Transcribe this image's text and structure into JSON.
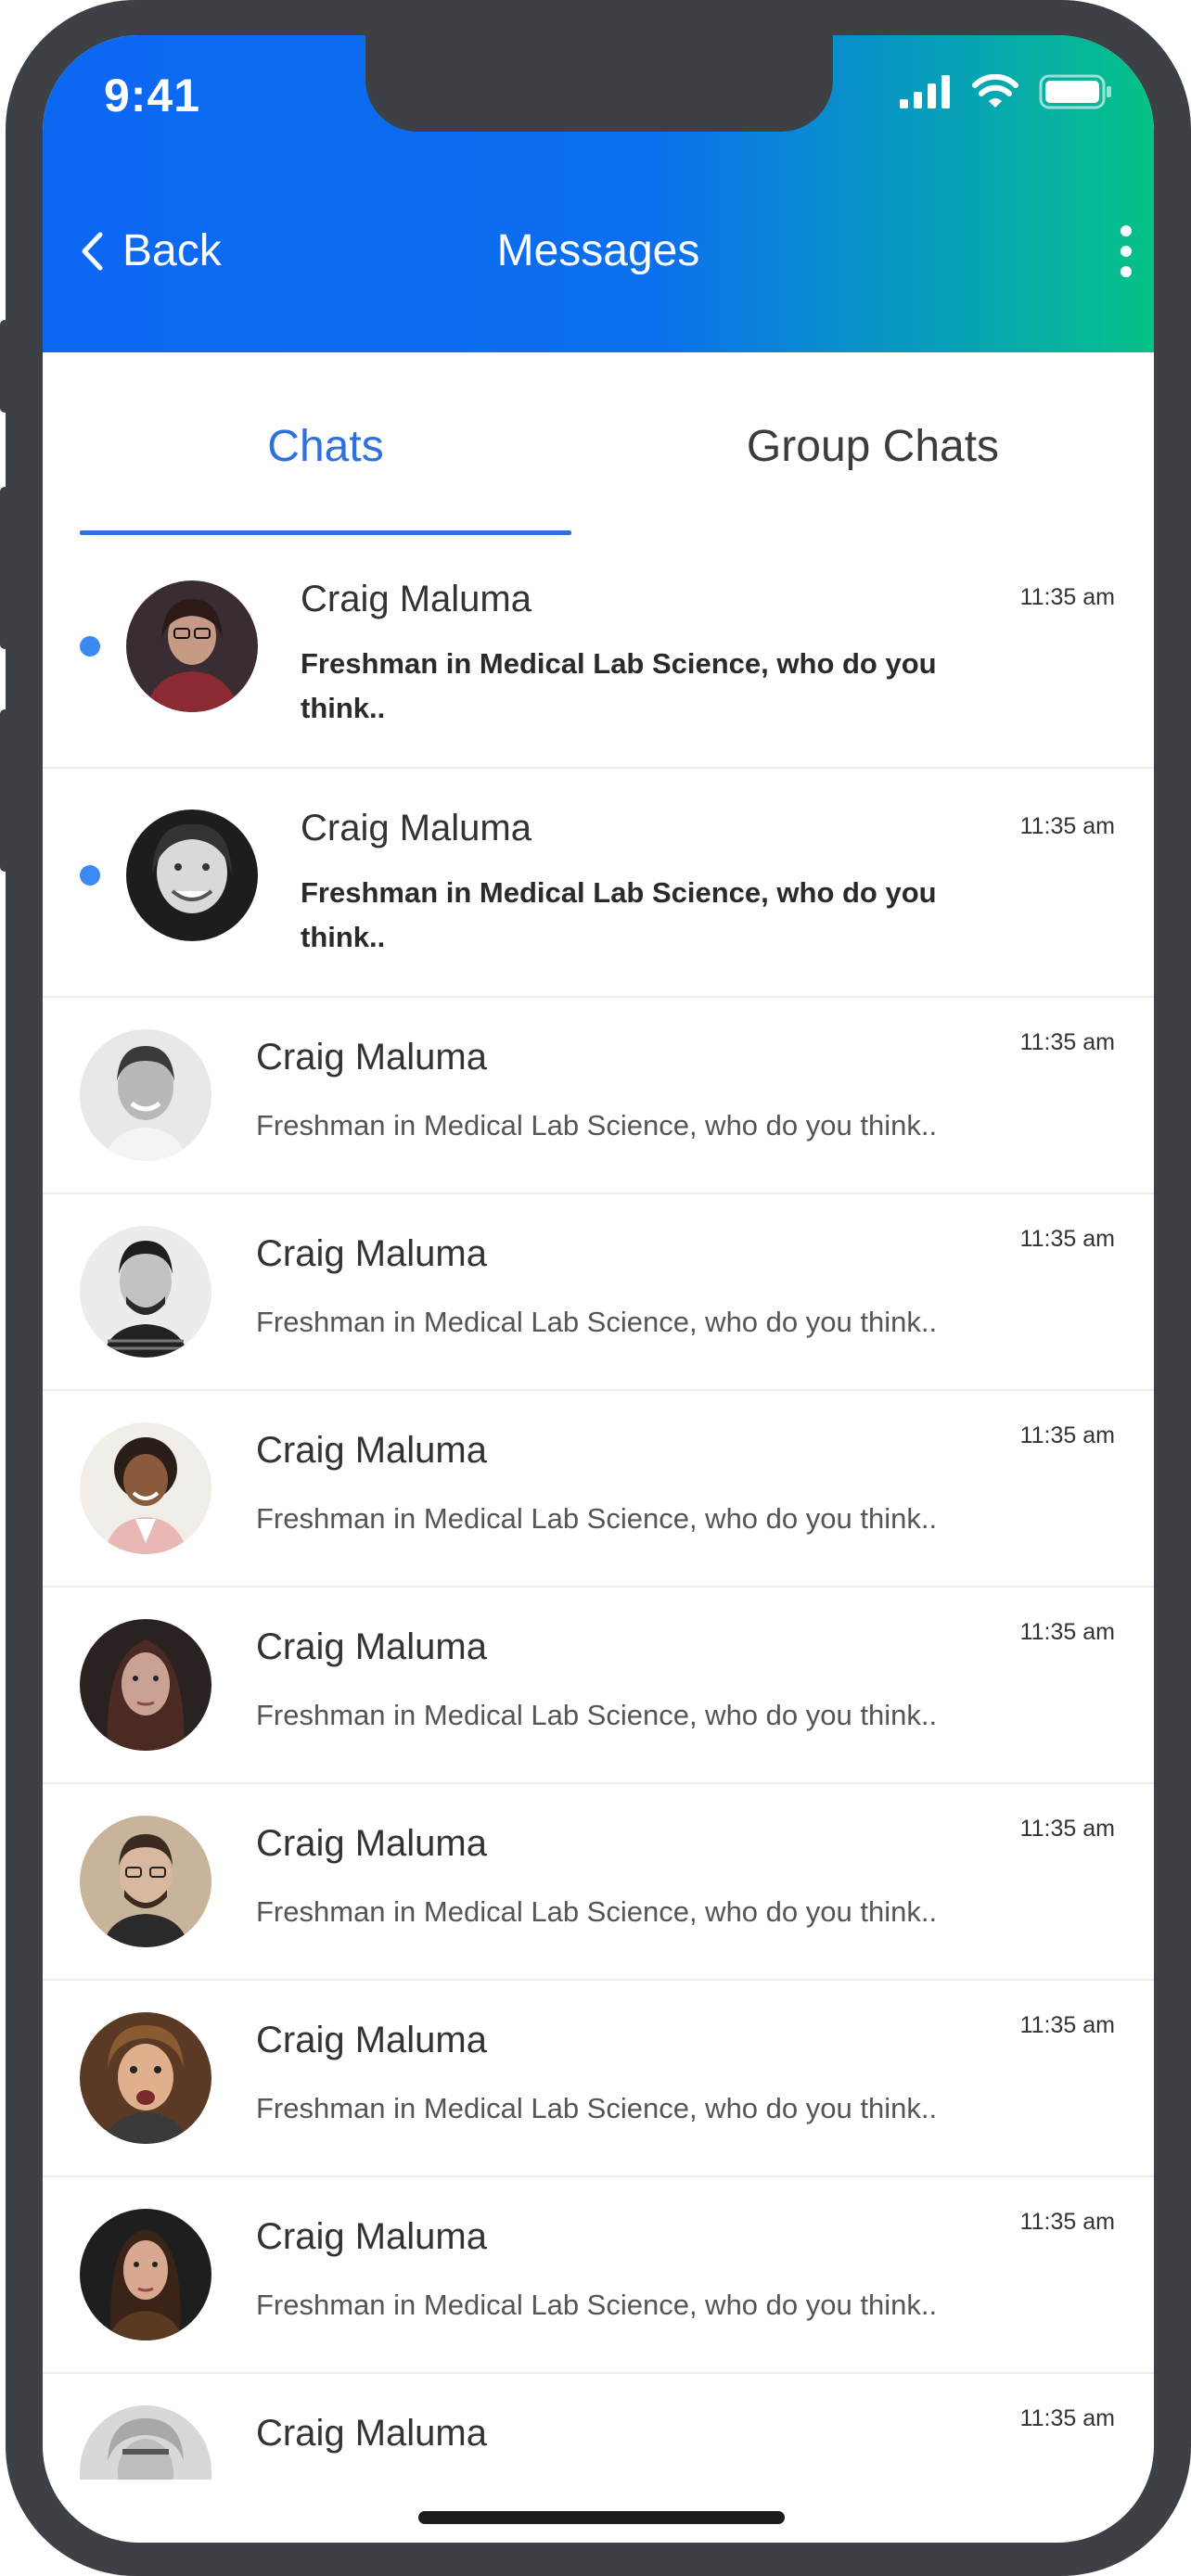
{
  "status_bar": {
    "time": "9:41"
  },
  "header": {
    "back_label": "Back",
    "title": "Messages"
  },
  "tabs": [
    {
      "label": "Chats",
      "active": true
    },
    {
      "label": "Group Chats",
      "active": false
    }
  ],
  "accent_color": "#2f6fde",
  "conversations": [
    {
      "name": "Craig Maluma",
      "message": "Freshman in Medical Lab Science, who do you think..",
      "time": "11:35 am",
      "unread": true
    },
    {
      "name": "Craig Maluma",
      "message": "Freshman in Medical Lab Science, who do you think..",
      "time": "11:35 am",
      "unread": true
    },
    {
      "name": "Craig Maluma",
      "message": "Freshman in Medical Lab Science, who do you think..",
      "time": "11:35 am",
      "unread": false
    },
    {
      "name": "Craig Maluma",
      "message": "Freshman in Medical Lab Science, who do you think..",
      "time": "11:35 am",
      "unread": false
    },
    {
      "name": "Craig Maluma",
      "message": "Freshman in Medical Lab Science, who do you think..",
      "time": "11:35 am",
      "unread": false
    },
    {
      "name": "Craig Maluma",
      "message": "Freshman in Medical Lab Science, who do you think..",
      "time": "11:35 am",
      "unread": false
    },
    {
      "name": "Craig Maluma",
      "message": "Freshman in Medical Lab Science, who do you think..",
      "time": "11:35 am",
      "unread": false
    },
    {
      "name": "Craig Maluma",
      "message": "Freshman in Medical Lab Science, who do you think..",
      "time": "11:35 am",
      "unread": false
    },
    {
      "name": "Craig Maluma",
      "message": "Freshman in Medical Lab Science, who do you think..",
      "time": "11:35 am",
      "unread": false
    },
    {
      "name": "Craig Maluma",
      "message": "",
      "time": "11:35 am",
      "unread": false
    }
  ]
}
